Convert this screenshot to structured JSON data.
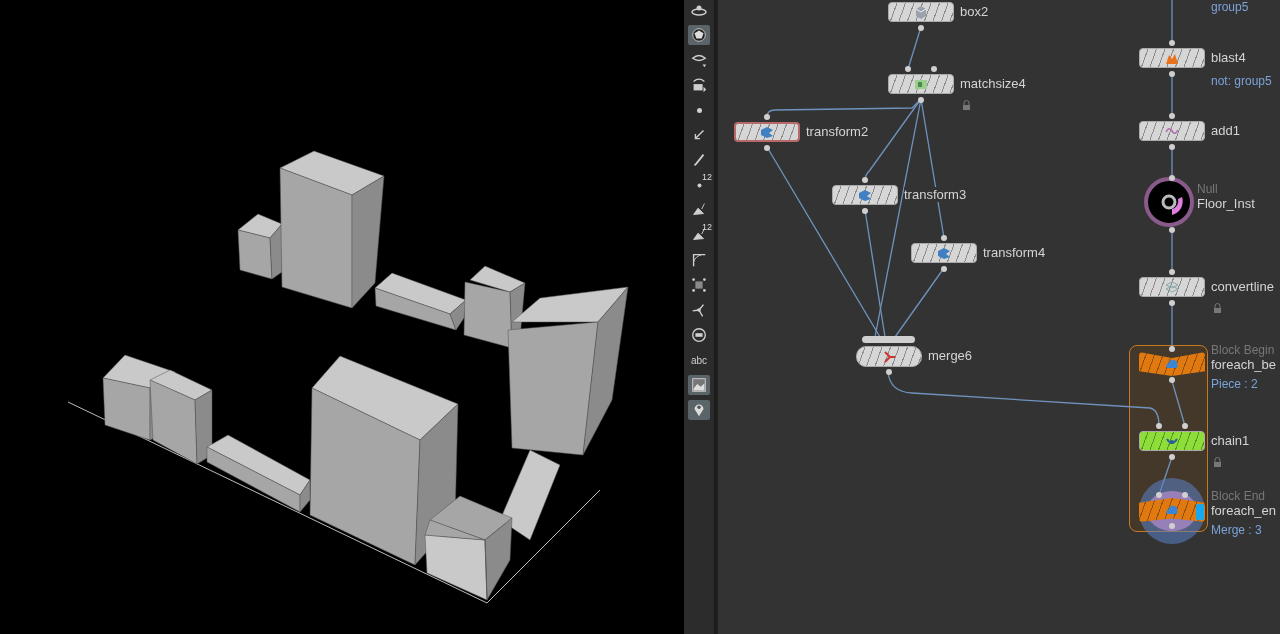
{
  "toolbar": [
    {
      "kind": "view",
      "selected": false
    },
    {
      "kind": "sphere",
      "selected": true
    },
    {
      "kind": "eye",
      "selected": false
    },
    {
      "kind": "camera",
      "selected": false
    },
    {
      "kind": "dot",
      "selected": false
    },
    {
      "kind": "arrow",
      "selected": false
    },
    {
      "kind": "pen",
      "selected": false
    },
    {
      "kind": "points",
      "label": "12",
      "selected": false
    },
    {
      "kind": "brush",
      "selected": false
    },
    {
      "kind": "brush",
      "label": "12",
      "selected": false
    },
    {
      "kind": "corner",
      "selected": false
    },
    {
      "kind": "grid",
      "selected": false
    },
    {
      "kind": "tripod",
      "selected": false
    },
    {
      "kind": "circle",
      "selected": false
    },
    {
      "kind": "text",
      "label": "abc",
      "selected": false
    },
    {
      "kind": "image",
      "selected": true
    },
    {
      "kind": "pin",
      "selected": true
    }
  ],
  "network": {
    "offscreen_comment": "group5",
    "nodes": [
      {
        "kind": "sop",
        "name": "box2",
        "color": "#d6d6d6",
        "locked": false,
        "selected": false
      },
      {
        "kind": "sop",
        "name": "matchsize4",
        "color": "#d6d6d6",
        "locked": true,
        "selected": false
      },
      {
        "kind": "sop",
        "name": "transform2",
        "color": "#d6d6d6",
        "locked": false,
        "selected": true
      },
      {
        "kind": "sop",
        "name": "transform3",
        "color": "#d6d6d6",
        "locked": false,
        "selected": false
      },
      {
        "kind": "sop",
        "name": "transform4",
        "color": "#d6d6d6",
        "locked": false,
        "selected": false
      },
      {
        "kind": "merge",
        "name": "merge6",
        "color": "#d6d6d6",
        "locked": false,
        "selected": false
      },
      {
        "kind": "sop",
        "name": "blast4",
        "comment": "not: group5",
        "color": "#d6d6d6",
        "locked": false,
        "selected": false
      },
      {
        "kind": "sop",
        "name": "add1",
        "color": "#d6d6d6",
        "locked": false,
        "selected": false
      },
      {
        "kind": "null",
        "name": "Floor_Inst",
        "type_label": "Null",
        "color": "#000000",
        "locked": false,
        "selected": false
      },
      {
        "kind": "sop",
        "name": "convertline",
        "color": "#d6d6d6",
        "locked": true,
        "selected": false
      },
      {
        "kind": "block_begin",
        "name": "foreach_be",
        "type_label": "Block Begin",
        "comment": "Piece : 2",
        "color": "#e07a10",
        "locked": false,
        "selected": false
      },
      {
        "kind": "sop",
        "name": "chain1",
        "color": "#8ede3a",
        "locked": true,
        "selected": false
      },
      {
        "kind": "block_end",
        "name": "foreach_en",
        "type_label": "Block End",
        "comment": "Merge : 3",
        "color": "#e07a10",
        "locked": false,
        "selected": false
      }
    ]
  }
}
